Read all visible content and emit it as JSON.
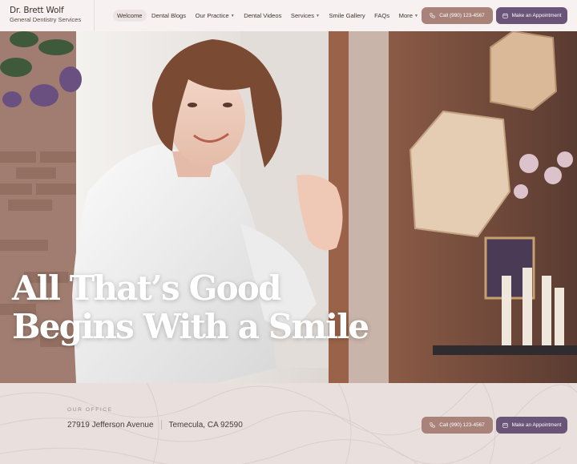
{
  "brand": {
    "name": "Dr. Brett Wolf",
    "subtitle": "General Dentistry Services"
  },
  "nav": {
    "welcome": "Welcome",
    "dental_blogs": "Dental Blogs",
    "our_practice": "Our Practice",
    "dental_videos": "Dental Videos",
    "services": "Services",
    "smile_gallery": "Smile Gallery",
    "faqs": "FAQs",
    "more": "More"
  },
  "header_buttons": {
    "call": "Call (990) 123-4567",
    "appointment": "Make an Appointment"
  },
  "hero": {
    "line1": "All That’s Good",
    "line2": "Begins With a Smile"
  },
  "office": {
    "label": "OUR OFFICE",
    "street": "27919 Jefferson Avenue",
    "city": "Temecula, CA 92590",
    "call": "Call (990) 123-4567",
    "appointment": "Make an Appointment"
  },
  "colors": {
    "call_button": "#a9837a",
    "appointment_button": "#6a5578",
    "header_bg": "#f7f2f1",
    "office_bg": "#e9dfdd"
  }
}
